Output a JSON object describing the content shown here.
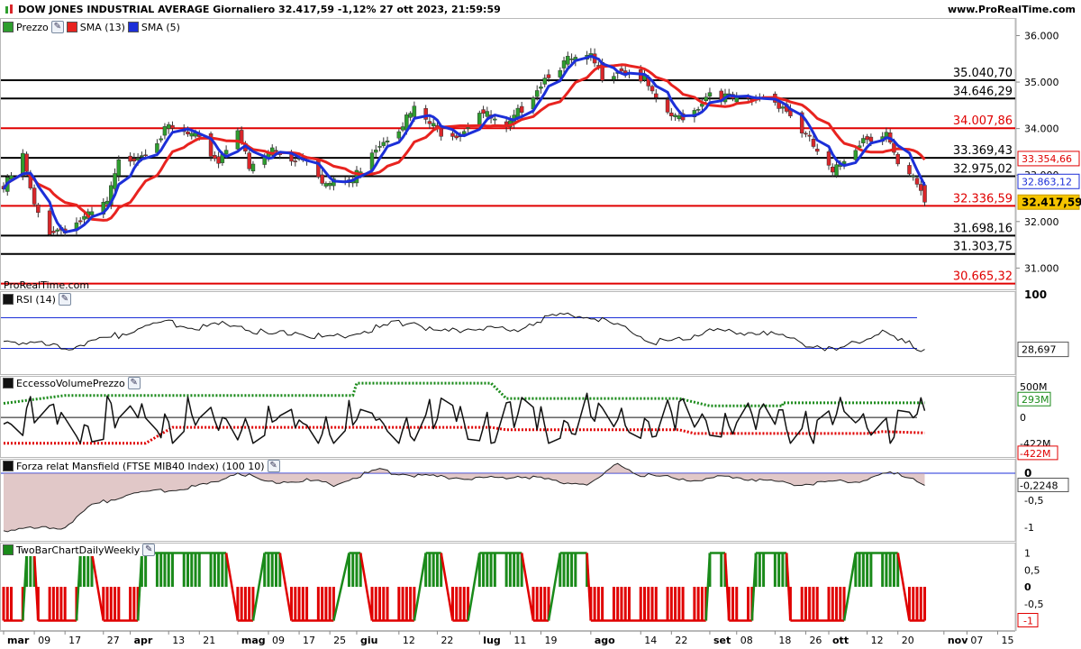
{
  "header": {
    "title": "DOW JONES INDUSTRIAL AVERAGE Giornaliero 32.417,59 -1,12% 27 ott 2023, 21:59:59",
    "site": "www.ProRealTime.com"
  },
  "watermark": "ProRealTime.com",
  "chart_data": [
    {
      "type": "candlestick",
      "name": "price",
      "legend": [
        "Prezzo",
        "SMA (13)",
        "SMA (5)"
      ],
      "colors": {
        "up": "#2e9e2e",
        "down": "#d9262a",
        "sma13": "#e8231f",
        "sma5": "#1c2fd8",
        "close_box": "#f5c400"
      },
      "ylim": [
        30600,
        36300
      ],
      "ticks": [
        {
          "v": 31000,
          "t": "31.000"
        },
        {
          "v": 32000,
          "t": "32.000"
        },
        {
          "v": 33000,
          "t": "33.000"
        },
        {
          "v": 34000,
          "t": "34.000"
        },
        {
          "v": 35000,
          "t": "35.000"
        },
        {
          "v": 36000,
          "t": "36.000"
        }
      ],
      "levels": [
        {
          "v": 35040.7,
          "t": "35.040,70",
          "c": "#000000"
        },
        {
          "v": 34646.29,
          "t": "34.646,29",
          "c": "#000000"
        },
        {
          "v": 34007.86,
          "t": "34.007,86",
          "c": "#e00000"
        },
        {
          "v": 33369.43,
          "t": "33.369,43",
          "c": "#000000"
        },
        {
          "v": 32975.02,
          "t": "32.975,02",
          "c": "#000000"
        },
        {
          "v": 32336.59,
          "t": "32.336,59",
          "c": "#e00000"
        },
        {
          "v": 31698.16,
          "t": "31.698,16",
          "c": "#000000"
        },
        {
          "v": 31303.75,
          "t": "31.303,75",
          "c": "#000000"
        },
        {
          "v": 30665.32,
          "t": "30.665,32",
          "c": "#e00000"
        }
      ],
      "last_values": [
        {
          "v": 33354.66,
          "t": "33.354,66",
          "style": "red"
        },
        {
          "v": 32863.12,
          "t": "32.863,12",
          "style": "blue"
        },
        {
          "v": 32417.59,
          "t": "32.417,59",
          "style": "close"
        }
      ],
      "closes": [
        {
          "date": "2023-03-01",
          "close": 32700
        },
        {
          "date": "2023-03-06",
          "close": 33400
        },
        {
          "date": "2023-03-09",
          "close": 32300
        },
        {
          "date": "2023-03-13",
          "close": 31800
        },
        {
          "date": "2023-03-17",
          "close": 31850
        },
        {
          "date": "2023-03-23",
          "close": 32100
        },
        {
          "date": "2023-03-28",
          "close": 32400
        },
        {
          "date": "2023-03-31",
          "close": 33250
        },
        {
          "date": "2023-04-06",
          "close": 33480
        },
        {
          "date": "2023-04-13",
          "close": 34000
        },
        {
          "date": "2023-04-20",
          "close": 33800
        },
        {
          "date": "2023-04-26",
          "close": 33300
        },
        {
          "date": "2023-05-01",
          "close": 34050
        },
        {
          "date": "2023-05-04",
          "close": 33100
        },
        {
          "date": "2023-05-10",
          "close": 33550
        },
        {
          "date": "2023-05-15",
          "close": 33350
        },
        {
          "date": "2023-05-19",
          "close": 33400
        },
        {
          "date": "2023-05-24",
          "close": 32800
        },
        {
          "date": "2023-05-31",
          "close": 32900
        },
        {
          "date": "2023-06-05",
          "close": 33550
        },
        {
          "date": "2023-06-12",
          "close": 34050
        },
        {
          "date": "2023-06-16",
          "close": 34400
        },
        {
          "date": "2023-06-22",
          "close": 33950
        },
        {
          "date": "2023-06-28",
          "close": 33900
        },
        {
          "date": "2023-07-03",
          "close": 34400
        },
        {
          "date": "2023-07-10",
          "close": 33950
        },
        {
          "date": "2023-07-14",
          "close": 34450
        },
        {
          "date": "2023-07-21",
          "close": 35200
        },
        {
          "date": "2023-07-26",
          "close": 35450
        },
        {
          "date": "2023-08-01",
          "close": 35500
        },
        {
          "date": "2023-08-04",
          "close": 35150
        },
        {
          "date": "2023-08-09",
          "close": 35300
        },
        {
          "date": "2023-08-15",
          "close": 35050
        },
        {
          "date": "2023-08-18",
          "close": 34550
        },
        {
          "date": "2023-08-23",
          "close": 34200
        },
        {
          "date": "2023-08-28",
          "close": 34400
        },
        {
          "date": "2023-09-01",
          "close": 34800
        },
        {
          "date": "2023-09-06",
          "close": 34650
        },
        {
          "date": "2023-09-11",
          "close": 34550
        },
        {
          "date": "2023-09-15",
          "close": 34700
        },
        {
          "date": "2023-09-20",
          "close": 34500
        },
        {
          "date": "2023-09-25",
          "close": 33950
        },
        {
          "date": "2023-09-29",
          "close": 33500
        },
        {
          "date": "2023-10-03",
          "close": 33000
        },
        {
          "date": "2023-10-06",
          "close": 33350
        },
        {
          "date": "2023-10-11",
          "close": 33800
        },
        {
          "date": "2023-10-17",
          "close": 33900
        },
        {
          "date": "2023-10-20",
          "close": 33150
        },
        {
          "date": "2023-10-24",
          "close": 32900
        },
        {
          "date": "2023-10-26",
          "close": 32700
        },
        {
          "date": "2023-10-27",
          "close": 32417.59
        }
      ]
    },
    {
      "type": "line",
      "name": "rsi",
      "legend": [
        "RSI (14)"
      ],
      "ylim": [
        0,
        100
      ],
      "ticks": [
        {
          "v": 100,
          "t": "100"
        }
      ],
      "bands": [
        70,
        30
      ],
      "last": {
        "v": 28.697,
        "t": "28,697"
      },
      "points": [
        {
          "date": "2023-03-01",
          "v": 42
        },
        {
          "date": "2023-03-09",
          "v": 36
        },
        {
          "date": "2023-03-17",
          "v": 30
        },
        {
          "date": "2023-03-28",
          "v": 42
        },
        {
          "date": "2023-04-06",
          "v": 58
        },
        {
          "date": "2023-04-13",
          "v": 64
        },
        {
          "date": "2023-04-21",
          "v": 58
        },
        {
          "date": "2023-05-01",
          "v": 62
        },
        {
          "date": "2023-05-09",
          "v": 47
        },
        {
          "date": "2023-05-17",
          "v": 52
        },
        {
          "date": "2023-05-25",
          "v": 42
        },
        {
          "date": "2023-06-05",
          "v": 55
        },
        {
          "date": "2023-06-15",
          "v": 66
        },
        {
          "date": "2023-06-22",
          "v": 50
        },
        {
          "date": "2023-07-03",
          "v": 58
        },
        {
          "date": "2023-07-11",
          "v": 52
        },
        {
          "date": "2023-07-19",
          "v": 68
        },
        {
          "date": "2023-07-27",
          "v": 76
        },
        {
          "date": "2023-08-02",
          "v": 70
        },
        {
          "date": "2023-08-09",
          "v": 58
        },
        {
          "date": "2023-08-18",
          "v": 38
        },
        {
          "date": "2023-08-25",
          "v": 40
        },
        {
          "date": "2023-09-01",
          "v": 58
        },
        {
          "date": "2023-09-08",
          "v": 48
        },
        {
          "date": "2023-09-15",
          "v": 54
        },
        {
          "date": "2023-09-22",
          "v": 40
        },
        {
          "date": "2023-09-29",
          "v": 34
        },
        {
          "date": "2023-10-04",
          "v": 26
        },
        {
          "date": "2023-10-10",
          "v": 40
        },
        {
          "date": "2023-10-16",
          "v": 54
        },
        {
          "date": "2023-10-20",
          "v": 40
        },
        {
          "date": "2023-10-24",
          "v": 34
        },
        {
          "date": "2023-10-27",
          "v": 28.697
        }
      ]
    },
    {
      "type": "line",
      "name": "volume_excess",
      "legend": [
        "EccessoVolumePrezzo"
      ],
      "unit": "M",
      "ylim": [
        -600,
        620
      ],
      "ticks": [
        {
          "v": 500,
          "t": "500M"
        },
        {
          "v": 0,
          "t": "0"
        },
        {
          "v": -422,
          "t": "-422M"
        }
      ],
      "upper_band_last": {
        "v": 293,
        "t": "293M"
      },
      "lower_band_last": {
        "v": -422,
        "t": "-422M"
      },
      "upper_band": [
        {
          "date": "2023-03-01",
          "v": 230
        },
        {
          "date": "2023-03-17",
          "v": 360
        },
        {
          "date": "2023-05-31",
          "v": 360
        },
        {
          "date": "2023-06-01",
          "v": 560
        },
        {
          "date": "2023-07-06",
          "v": 560
        },
        {
          "date": "2023-07-10",
          "v": 310
        },
        {
          "date": "2023-08-24",
          "v": 310
        },
        {
          "date": "2023-09-01",
          "v": 190
        },
        {
          "date": "2023-09-20",
          "v": 190
        },
        {
          "date": "2023-09-20",
          "v": 240
        },
        {
          "date": "2023-10-27",
          "v": 240
        }
      ],
      "lower_band": [
        {
          "date": "2023-03-01",
          "v": -420
        },
        {
          "date": "2023-04-07",
          "v": -420
        },
        {
          "date": "2023-04-14",
          "v": -160
        },
        {
          "date": "2023-07-06",
          "v": -160
        },
        {
          "date": "2023-07-10",
          "v": -200
        },
        {
          "date": "2023-08-24",
          "v": -200
        },
        {
          "date": "2023-08-28",
          "v": -260
        },
        {
          "date": "2023-10-12",
          "v": -260
        },
        {
          "date": "2023-10-16",
          "v": -230
        },
        {
          "date": "2023-10-27",
          "v": -250
        }
      ]
    },
    {
      "type": "area",
      "name": "mansfield",
      "legend": [
        "Forza relat Mansfield (FTSE MIB40 Index) (100 10)"
      ],
      "ylim": [
        -1.2,
        0.2
      ],
      "ticks": [
        {
          "v": 0,
          "t": "0"
        },
        {
          "v": -0.5,
          "t": "-0,5"
        },
        {
          "v": -1,
          "t": "-1"
        }
      ],
      "last": {
        "v": -0.2248,
        "t": "-0,2248"
      },
      "points": [
        {
          "date": "2023-03-01",
          "v": -1.05
        },
        {
          "date": "2023-03-17",
          "v": -1.0
        },
        {
          "date": "2023-03-24",
          "v": -0.6
        },
        {
          "date": "2023-04-03",
          "v": -0.38
        },
        {
          "date": "2023-04-14",
          "v": -0.3
        },
        {
          "date": "2023-04-24",
          "v": -0.2
        },
        {
          "date": "2023-05-01",
          "v": 0.03
        },
        {
          "date": "2023-05-09",
          "v": -0.18
        },
        {
          "date": "2023-05-18",
          "v": -0.12
        },
        {
          "date": "2023-05-26",
          "v": -0.22
        },
        {
          "date": "2023-06-06",
          "v": 0.06
        },
        {
          "date": "2023-06-15",
          "v": -0.04
        },
        {
          "date": "2023-06-26",
          "v": -0.08
        },
        {
          "date": "2023-07-05",
          "v": -0.1
        },
        {
          "date": "2023-07-14",
          "v": -0.05
        },
        {
          "date": "2023-07-24",
          "v": -0.15
        },
        {
          "date": "2023-08-01",
          "v": -0.2
        },
        {
          "date": "2023-08-08",
          "v": 0.18
        },
        {
          "date": "2023-08-14",
          "v": -0.03
        },
        {
          "date": "2023-08-21",
          "v": -0.08
        },
        {
          "date": "2023-08-29",
          "v": -0.12
        },
        {
          "date": "2023-09-05",
          "v": -0.06
        },
        {
          "date": "2023-09-12",
          "v": -0.1
        },
        {
          "date": "2023-09-19",
          "v": -0.18
        },
        {
          "date": "2023-09-26",
          "v": -0.2
        },
        {
          "date": "2023-10-03",
          "v": -0.16
        },
        {
          "date": "2023-10-10",
          "v": -0.14
        },
        {
          "date": "2023-10-17",
          "v": 0.0
        },
        {
          "date": "2023-10-23",
          "v": -0.05
        },
        {
          "date": "2023-10-27",
          "v": -0.2248
        }
      ]
    },
    {
      "type": "bar",
      "name": "twobar",
      "legend": [
        "TwoBarChartDailyWeekly"
      ],
      "ylim": [
        -1.2,
        1.2
      ],
      "ticks": [
        {
          "v": 1,
          "t": "1"
        },
        {
          "v": 0.5,
          "t": "0,5"
        },
        {
          "v": 0,
          "t": "0"
        },
        {
          "v": -0.5,
          "t": "-0,5"
        }
      ],
      "last": {
        "v": -1,
        "t": "-1"
      },
      "colors": {
        "up": "#1a8a1a",
        "down": "#e00000"
      },
      "regimes": [
        {
          "from": "2023-03-01",
          "to": "2023-03-06",
          "v": -1
        },
        {
          "from": "2023-03-07",
          "to": "2023-03-09",
          "v": 1
        },
        {
          "from": "2023-03-10",
          "to": "2023-03-20",
          "v": -1
        },
        {
          "from": "2023-03-21",
          "to": "2023-03-24",
          "v": 1
        },
        {
          "from": "2023-03-27",
          "to": "2023-04-05",
          "v": -1
        },
        {
          "from": "2023-04-06",
          "to": "2023-04-28",
          "v": 1
        },
        {
          "from": "2023-05-01",
          "to": "2023-05-05",
          "v": -1
        },
        {
          "from": "2023-05-08",
          "to": "2023-05-12",
          "v": 1
        },
        {
          "from": "2023-05-15",
          "to": "2023-05-26",
          "v": -1
        },
        {
          "from": "2023-05-30",
          "to": "2023-06-02",
          "v": 1
        },
        {
          "from": "2023-06-05",
          "to": "2023-06-16",
          "v": -1
        },
        {
          "from": "2023-06-19",
          "to": "2023-06-23",
          "v": 1
        },
        {
          "from": "2023-06-26",
          "to": "2023-06-30",
          "v": -1
        },
        {
          "from": "2023-07-03",
          "to": "2023-07-14",
          "v": 1
        },
        {
          "from": "2023-07-17",
          "to": "2023-07-21",
          "v": -1
        },
        {
          "from": "2023-07-24",
          "to": "2023-07-31",
          "v": 1
        },
        {
          "from": "2023-08-01",
          "to": "2023-08-31",
          "v": -1
        },
        {
          "from": "2023-09-01",
          "to": "2023-09-05",
          "v": 1
        },
        {
          "from": "2023-09-06",
          "to": "2023-09-12",
          "v": -1
        },
        {
          "from": "2023-09-13",
          "to": "2023-09-21",
          "v": 1
        },
        {
          "from": "2023-09-22",
          "to": "2023-10-06",
          "v": -1
        },
        {
          "from": "2023-10-09",
          "to": "2023-10-20",
          "v": 1
        },
        {
          "from": "2023-10-23",
          "to": "2023-10-27",
          "v": -1
        }
      ]
    }
  ],
  "xaxis": {
    "start": "2023-03-01",
    "end": "2023-11-17",
    "labels": [
      {
        "date": "2023-03-01",
        "t": "mar",
        "bold": true
      },
      {
        "date": "2023-03-09",
        "t": "09"
      },
      {
        "date": "2023-03-17",
        "t": "17"
      },
      {
        "date": "2023-03-27",
        "t": "27"
      },
      {
        "date": "2023-04-03",
        "t": "apr",
        "bold": true
      },
      {
        "date": "2023-04-13",
        "t": "13"
      },
      {
        "date": "2023-04-21",
        "t": "21"
      },
      {
        "date": "2023-05-01",
        "t": "mag",
        "bold": true
      },
      {
        "date": "2023-05-09",
        "t": "09"
      },
      {
        "date": "2023-05-17",
        "t": "17"
      },
      {
        "date": "2023-05-25",
        "t": "25"
      },
      {
        "date": "2023-06-01",
        "t": "giu",
        "bold": true
      },
      {
        "date": "2023-06-12",
        "t": "12"
      },
      {
        "date": "2023-06-22",
        "t": "22"
      },
      {
        "date": "2023-07-03",
        "t": "lug",
        "bold": true
      },
      {
        "date": "2023-07-11",
        "t": "11"
      },
      {
        "date": "2023-07-19",
        "t": "19"
      },
      {
        "date": "2023-08-01",
        "t": "ago",
        "bold": true
      },
      {
        "date": "2023-08-14",
        "t": "14"
      },
      {
        "date": "2023-08-22",
        "t": "22"
      },
      {
        "date": "2023-09-01",
        "t": "set",
        "bold": true
      },
      {
        "date": "2023-09-08",
        "t": "08"
      },
      {
        "date": "2023-09-18",
        "t": "18"
      },
      {
        "date": "2023-09-26",
        "t": "26"
      },
      {
        "date": "2023-10-02",
        "t": "ott",
        "bold": true
      },
      {
        "date": "2023-10-12",
        "t": "12"
      },
      {
        "date": "2023-10-20",
        "t": "20"
      },
      {
        "date": "2023-11-01",
        "t": "nov",
        "bold": true
      },
      {
        "date": "2023-11-07",
        "t": "07"
      },
      {
        "date": "2023-11-15",
        "t": "15"
      }
    ]
  }
}
